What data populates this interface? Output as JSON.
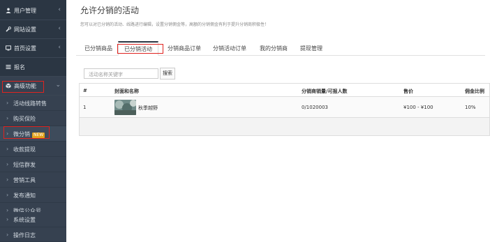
{
  "sidebar": {
    "items": [
      {
        "label": "用户管理",
        "icon": "user-icon"
      },
      {
        "label": "网站设置",
        "icon": "wrench-icon"
      },
      {
        "label": "首页设置",
        "icon": "monitor-icon"
      },
      {
        "label": "报名",
        "icon": "list-icon"
      },
      {
        "label": "高级功能",
        "icon": "cube-icon"
      }
    ],
    "submenu": [
      {
        "label": "活动线路转售"
      },
      {
        "label": "购买保险"
      },
      {
        "label": "微分销",
        "badge": "NEW"
      },
      {
        "label": "收款提现"
      },
      {
        "label": "短信群发"
      },
      {
        "label": "营销工具"
      },
      {
        "label": "发布通知"
      },
      {
        "label": "微信公众号"
      },
      {
        "label": "系统设置"
      },
      {
        "label": "操作日志"
      }
    ]
  },
  "page": {
    "title": "允许分销的活动",
    "description": "您可以对已分销的活动、线路进行编辑，设置分销佣金等，高额的分销佣金有利于提升分销商积极性！"
  },
  "tabs": [
    "已分销商品",
    "已分销活动",
    "分销商品订单",
    "分销活动订单",
    "我的分销商",
    "提现管理"
  ],
  "search": {
    "placeholder": "活动名称关键字",
    "button_label": "搜索"
  },
  "table": {
    "columns": [
      "#",
      "封面和名称",
      "分销商销量/可报人数",
      "售价",
      "佣金比例"
    ],
    "rows": [
      {
        "index": "1",
        "name": "秋季越野",
        "sales": "0/1020003",
        "price": "¥100 - ¥100",
        "commission": "10%"
      }
    ]
  }
}
